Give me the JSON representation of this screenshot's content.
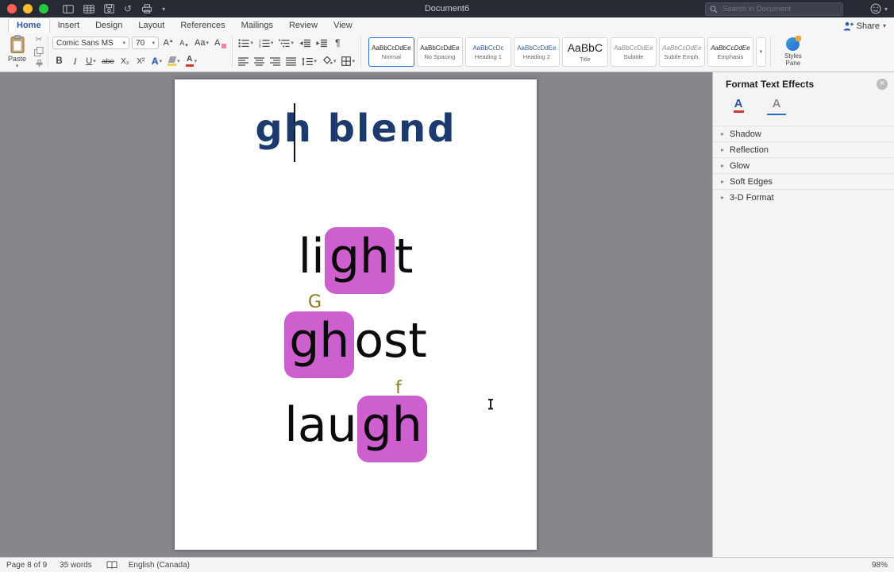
{
  "colors": {
    "highlight": "#ce5fce",
    "doc_title": "#1c3a6e",
    "annotation": "#8f7a1a",
    "accent": "#2b579a"
  },
  "titlebar": {
    "title": "Document6",
    "search_placeholder": "Search in Document"
  },
  "tabs": {
    "home": "Home",
    "insert": "Insert",
    "design": "Design",
    "layout": "Layout",
    "references": "References",
    "mailings": "Mailings",
    "review": "Review",
    "view": "View"
  },
  "share_label": "Share",
  "ribbon": {
    "paste_label": "Paste",
    "font_name": "Comic Sans MS",
    "font_size": "70",
    "styles": [
      {
        "sample": "AaBbCcDdEe",
        "name": "Normal"
      },
      {
        "sample": "AaBbCcDdEe",
        "name": "No Spacing"
      },
      {
        "sample": "AaBbCcDc",
        "name": "Heading 1"
      },
      {
        "sample": "AaBbCcDdEe",
        "name": "Heading 2"
      },
      {
        "sample": "AaBbC",
        "name": "Title"
      },
      {
        "sample": "AaBbCcDdEe",
        "name": "Subtitle"
      },
      {
        "sample": "AaBbCcDdEe",
        "name": "Subtle Emph."
      },
      {
        "sample": "AaBbCcDdEe",
        "name": "Emphasis"
      }
    ],
    "styles_pane_label": "Styles Pane"
  },
  "glyphs": {
    "caret_down": "▾",
    "caret_up": "▴",
    "disclosure": "▸",
    "scissors": "✂",
    "undo": "↺",
    "pilcrow": "¶",
    "close": "×",
    "bold": "B",
    "italic": "I",
    "underline": "U",
    "strikethrough": "abe",
    "subscript": "X₂",
    "superscript": "X²",
    "change_case": "Aa",
    "text_effects": "A",
    "font_color": "A",
    "clear_format": "A",
    "grow_font": "A",
    "shrink_font": "A"
  },
  "document": {
    "title": "gh blend",
    "words": [
      {
        "pre": "li",
        "hl": "gh",
        "post": "t"
      },
      {
        "pre": "",
        "hl": "gh",
        "post": "ost"
      },
      {
        "pre": "lau",
        "hl": "gh",
        "post": ""
      }
    ],
    "annotations": {
      "ghost": "G",
      "laugh": "f"
    }
  },
  "panel": {
    "title": "Format Text Effects",
    "sections": [
      {
        "label": "Shadow"
      },
      {
        "label": "Reflection"
      },
      {
        "label": "Glow"
      },
      {
        "label": "Soft Edges"
      },
      {
        "label": "3-D Format"
      }
    ]
  },
  "statusbar": {
    "page": "Page 8 of 9",
    "words": "35 words",
    "language": "English (Canada)",
    "zoom": "98%"
  }
}
